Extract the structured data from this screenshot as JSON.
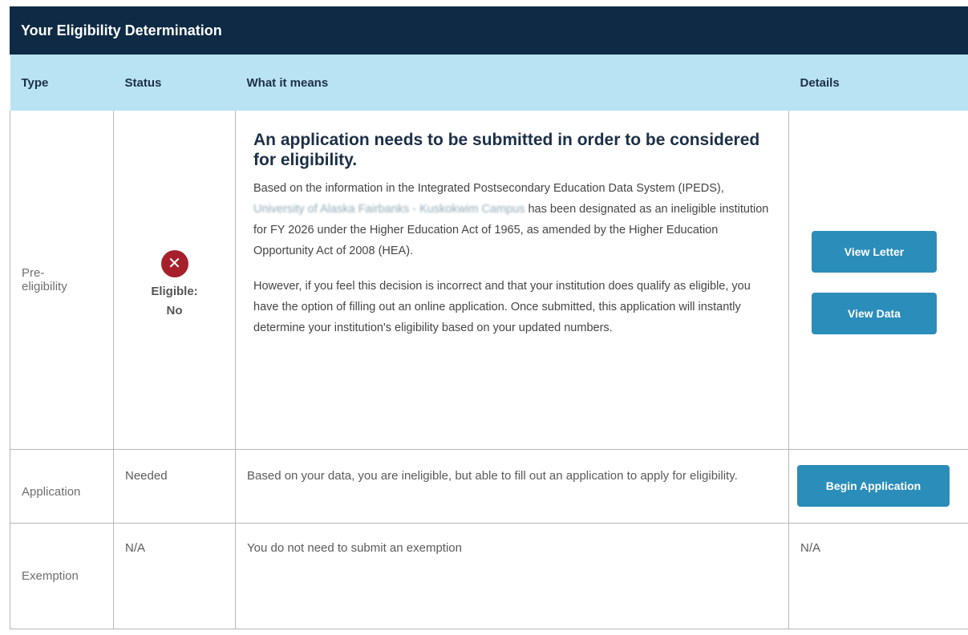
{
  "header": {
    "title": "Your Eligibility Determination"
  },
  "columns": {
    "type": "Type",
    "status": "Status",
    "means": "What it means",
    "details": "Details"
  },
  "rows": {
    "pre": {
      "type_line1": "Pre-",
      "type_line2": "eligibility",
      "status_icon": "x-circle-icon",
      "status_label": "Eligible:",
      "status_value": "No",
      "headline": "An application needs to be submitted in order to be considered for eligibility.",
      "para1_start": "Based on the information in the Integrated Postsecondary Education Data System (IPEDS), ",
      "para1_redacted": "University of Alaska Fairbanks - Kuskokwim Campus",
      "para1_end": " has been designated as an ineligible institution for FY 2026 under the Higher Education Act of 1965, as amended by the Higher Education Opportunity Act of 2008 (HEA).",
      "para2": "However, if you feel this decision is incorrect and that your institution does qualify as eligible, you have the option of filling out an online application. Once submitted, this application will instantly determine your institution's eligibility based on your updated numbers.",
      "btn_letter": "View Letter",
      "btn_data": "View Data"
    },
    "app": {
      "type": "Application",
      "status": "Needed",
      "means": "Based on your data, you are ineligible, but able to fill out an application to apply for eligibility.",
      "btn_begin": "Begin Application"
    },
    "ex": {
      "type": "Exemption",
      "status": "N/A",
      "means": "You do not need to submit an exemption",
      "details": "N/A"
    }
  },
  "colors": {
    "header_bg": "#0e2a44",
    "column_header_bg": "#b9e3f3",
    "button_bg": "#2b8dba",
    "ineligible_icon": "#a6202b"
  }
}
